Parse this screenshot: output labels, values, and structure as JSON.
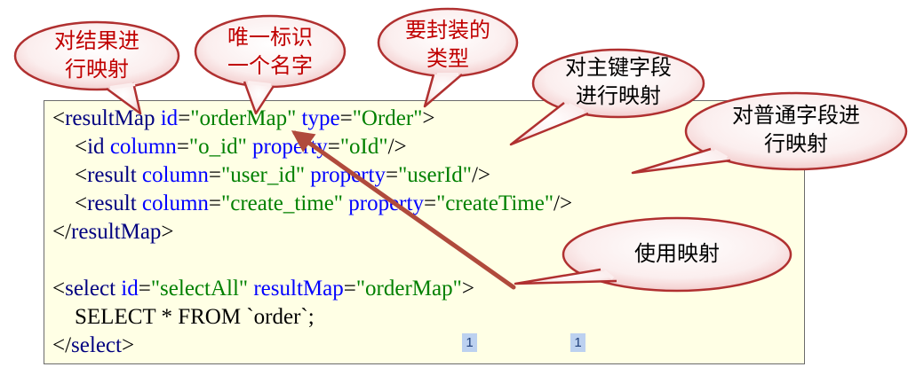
{
  "callouts": [
    {
      "id": "map-result",
      "text": "对结果进\n行映射",
      "color": "#c00000"
    },
    {
      "id": "unique-id",
      "text": "唯一标识\n一个名字",
      "color": "#c00000"
    },
    {
      "id": "wrapped-type",
      "text": "要封装的\n类型",
      "color": "#c00000"
    },
    {
      "id": "primary-key",
      "text": "对主键字段\n进行映射",
      "color": "#000000"
    },
    {
      "id": "normal-field",
      "text": "对普通字段进\n行映射",
      "color": "#000000"
    },
    {
      "id": "use-map",
      "text": "使用映射",
      "color": "#000000"
    }
  ],
  "code": {
    "lines": [
      [
        {
          "t": "punct",
          "v": "<"
        },
        {
          "t": "tag",
          "v": "resultMap "
        },
        {
          "t": "attr",
          "v": "id"
        },
        {
          "t": "punct",
          "v": "="
        },
        {
          "t": "str",
          "v": "\"orderMap\""
        },
        {
          "t": "attr",
          "v": " type"
        },
        {
          "t": "punct",
          "v": "="
        },
        {
          "t": "str",
          "v": "\"Order\""
        },
        {
          "t": "punct",
          "v": ">"
        }
      ],
      [
        {
          "t": "sql",
          "v": "    "
        },
        {
          "t": "punct",
          "v": "<"
        },
        {
          "t": "tag",
          "v": "id "
        },
        {
          "t": "attr",
          "v": "column"
        },
        {
          "t": "punct",
          "v": "="
        },
        {
          "t": "str",
          "v": "\"o_id\""
        },
        {
          "t": "attr",
          "v": " property"
        },
        {
          "t": "punct",
          "v": "="
        },
        {
          "t": "str",
          "v": "\"oId\""
        },
        {
          "t": "punct",
          "v": "/>"
        }
      ],
      [
        {
          "t": "sql",
          "v": "    "
        },
        {
          "t": "punct",
          "v": "<"
        },
        {
          "t": "tag",
          "v": "result "
        },
        {
          "t": "attr",
          "v": "column"
        },
        {
          "t": "punct",
          "v": "="
        },
        {
          "t": "str",
          "v": "\"user_id\""
        },
        {
          "t": "attr",
          "v": " property"
        },
        {
          "t": "punct",
          "v": "="
        },
        {
          "t": "str",
          "v": "\"userId\""
        },
        {
          "t": "punct",
          "v": "/>"
        }
      ],
      [
        {
          "t": "sql",
          "v": "    "
        },
        {
          "t": "punct",
          "v": "<"
        },
        {
          "t": "tag",
          "v": "result "
        },
        {
          "t": "attr",
          "v": "column"
        },
        {
          "t": "punct",
          "v": "="
        },
        {
          "t": "str",
          "v": "\"create_time\""
        },
        {
          "t": "attr",
          "v": " property"
        },
        {
          "t": "punct",
          "v": "="
        },
        {
          "t": "str",
          "v": "\"createTime\""
        },
        {
          "t": "punct",
          "v": "/>"
        }
      ],
      [
        {
          "t": "punct",
          "v": "</"
        },
        {
          "t": "tag",
          "v": "resultMap"
        },
        {
          "t": "punct",
          "v": ">"
        }
      ],
      [],
      [
        {
          "t": "punct",
          "v": "<"
        },
        {
          "t": "tag",
          "v": "select "
        },
        {
          "t": "attr",
          "v": "id"
        },
        {
          "t": "punct",
          "v": "="
        },
        {
          "t": "str",
          "v": "\"selectAll\""
        },
        {
          "t": "attr",
          "v": " resultMap"
        },
        {
          "t": "punct",
          "v": "="
        },
        {
          "t": "str",
          "v": "\"orderMap\""
        },
        {
          "t": "punct",
          "v": ">"
        }
      ],
      [
        {
          "t": "sql",
          "v": "    SELECT * FROM `order`;"
        }
      ],
      [
        {
          "t": "punct",
          "v": "</"
        },
        {
          "t": "tag",
          "v": "select"
        },
        {
          "t": "punct",
          "v": ">"
        }
      ]
    ]
  },
  "markers": [
    "1",
    "1"
  ],
  "colors": {
    "arrow": "#b04a3c",
    "bubble_stroke": "#b03030",
    "code_bg": "#ffffe5"
  }
}
